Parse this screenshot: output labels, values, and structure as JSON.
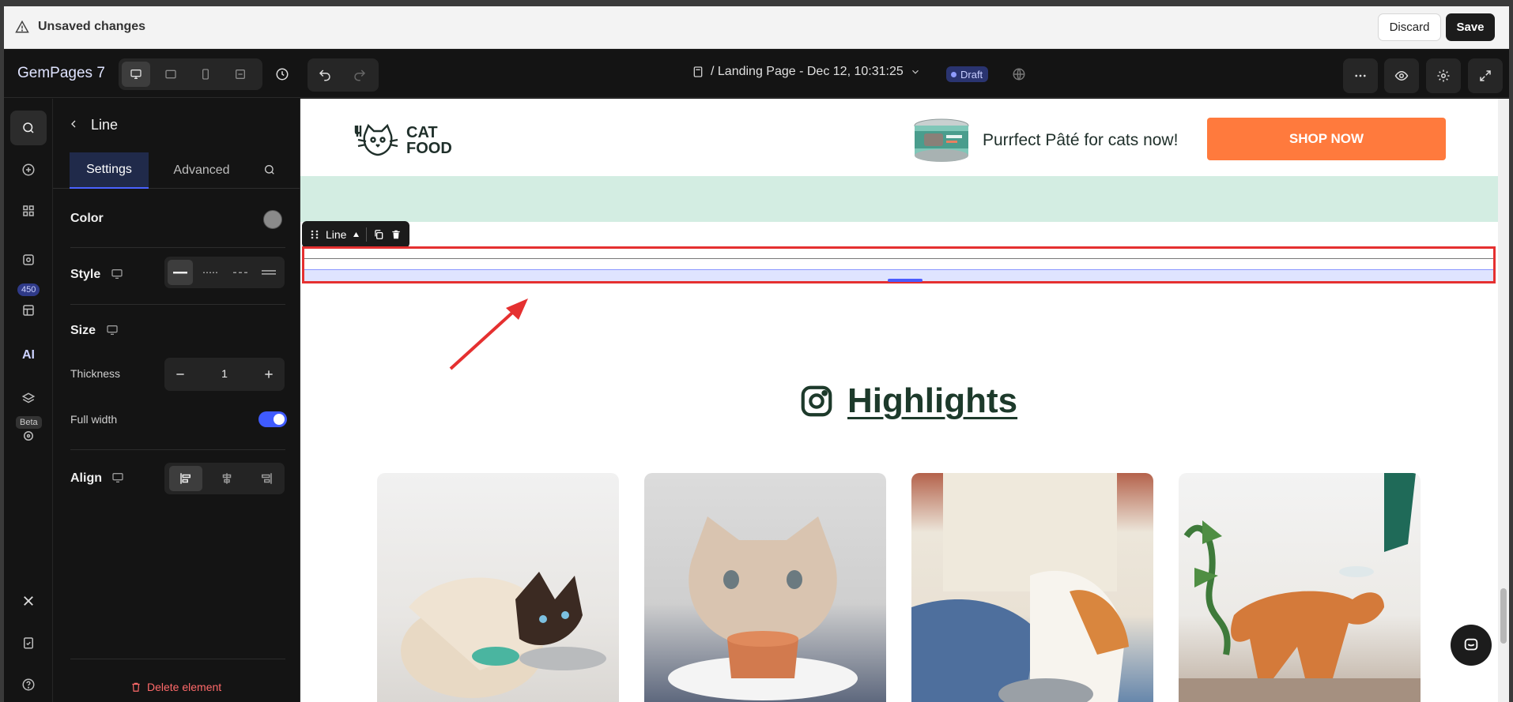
{
  "unsaved_bar": {
    "message": "Unsaved changes",
    "discard": "Discard",
    "save": "Save"
  },
  "toolbar": {
    "brand": "GemPages 7",
    "page_title": "/ Landing Page - Dec 12, 10:31:25",
    "status": "Draft"
  },
  "rail": {
    "badge_count": "450",
    "beta": "Beta"
  },
  "panel": {
    "title": "Line",
    "tabs": [
      "Settings",
      "Advanced"
    ],
    "color_label": "Color",
    "color_value": "#8a8a8a",
    "style_label": "Style",
    "size_label": "Size",
    "thickness_label": "Thickness",
    "thickness_value": "1",
    "full_width_label": "Full width",
    "full_width_on": true,
    "align_label": "Align",
    "delete_label": "Delete element"
  },
  "canvas": {
    "logo_text": "CAT FOOD",
    "promo_text": "Purrfect Pâté for cats now!",
    "shop_button": "SHOP NOW",
    "selected_element_label": "Line",
    "section_title": "Highlights",
    "accent_color": "#ff7a3d",
    "band_color": "#d3ede2"
  }
}
